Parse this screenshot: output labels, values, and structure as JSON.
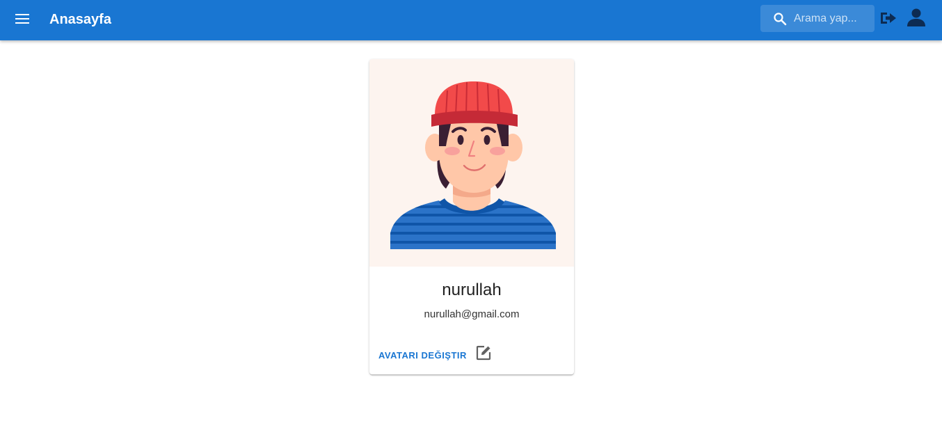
{
  "header": {
    "title": "Anasayfa",
    "menu_icon": "menu-icon",
    "search": {
      "placeholder": "Arama yap...",
      "value": "",
      "icon": "search-icon"
    },
    "logout_icon": "logout-icon",
    "account_icon": "account-icon",
    "colors": {
      "background": "#1976d2",
      "icon_dark": "#0d2b52"
    }
  },
  "profile": {
    "avatar_icon": "avatar-illustration",
    "name": "nurullah",
    "email": "nurullah@gmail.com",
    "change_avatar_label": "AVATARI DEĞIŞTIR",
    "edit_icon": "edit-icon"
  }
}
